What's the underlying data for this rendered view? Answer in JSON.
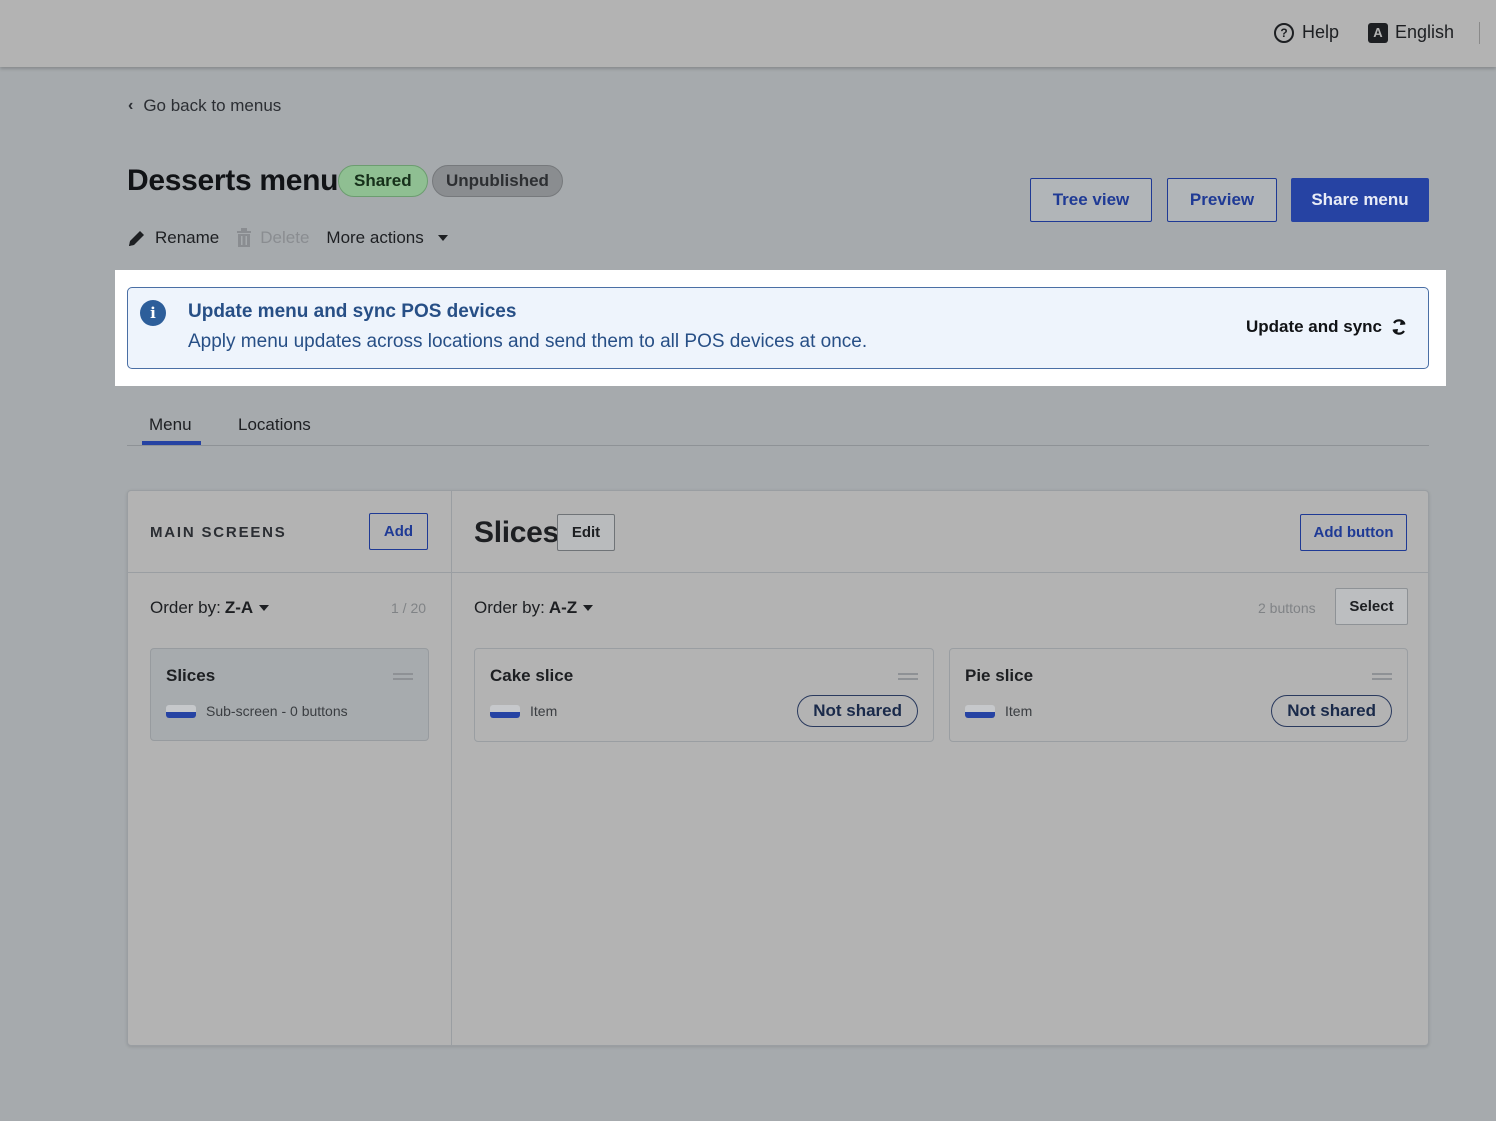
{
  "topbar": {
    "help_label": "Help",
    "language_label": "English",
    "language_icon_letter": "A"
  },
  "back": {
    "label": "Go back to menus"
  },
  "menu": {
    "title": "Desserts menu",
    "badges": {
      "shared": "Shared",
      "unpublished": "Unpublished"
    },
    "actions": {
      "rename": "Rename",
      "delete": "Delete",
      "more": "More actions"
    },
    "buttons": {
      "tree_view": "Tree view",
      "preview": "Preview",
      "share": "Share menu"
    }
  },
  "banner": {
    "title": "Update menu and sync POS devices",
    "description": "Apply menu updates across locations and send them to all POS devices at once.",
    "action": "Update and sync"
  },
  "tabs": [
    "Menu",
    "Locations"
  ],
  "left_panel": {
    "heading": "MAIN SCREENS",
    "add_label": "Add",
    "order_prefix": "Order by:",
    "order_value": "Z-A",
    "count": "1 / 20",
    "screens": [
      {
        "name": "Slices",
        "type": "Sub-screen - 0 buttons"
      }
    ]
  },
  "right_panel": {
    "title": "Slices",
    "edit_label": "Edit",
    "add_button_label": "Add button",
    "order_prefix": "Order by:",
    "order_value": "A-Z",
    "count": "2 buttons",
    "select_label": "Select",
    "items": [
      {
        "name": "Cake slice",
        "type": "Item",
        "status": "Not shared"
      },
      {
        "name": "Pie slice",
        "type": "Item",
        "status": "Not shared"
      }
    ]
  },
  "colors": {
    "primary": "#2643a3",
    "banner_text": "#274f86",
    "shared_badge": "#8fbf92"
  }
}
